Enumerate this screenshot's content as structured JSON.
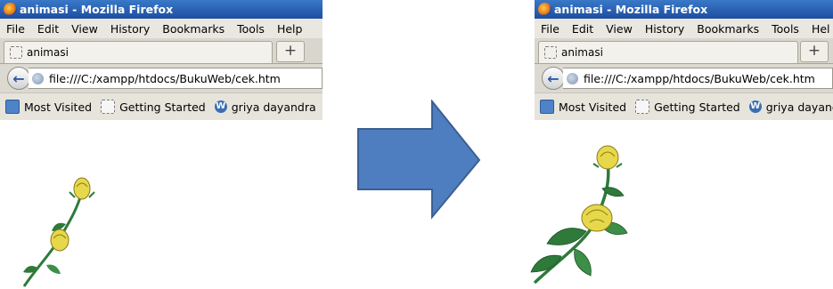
{
  "left_window": {
    "title": "animasi - Mozilla Firefox",
    "menu": [
      "File",
      "Edit",
      "View",
      "History",
      "Bookmarks",
      "Tools",
      "Help"
    ],
    "tab_label": "animasi",
    "new_tab_label": "+",
    "url": "file:///C:/xampp/htdocs/BukuWeb/cek.htm",
    "bookmarks": [
      "Most Visited",
      "Getting Started",
      "griya dayandra"
    ]
  },
  "right_window": {
    "title": "animasi - Mozilla Firefox",
    "menu": [
      "File",
      "Edit",
      "View",
      "History",
      "Bookmarks",
      "Tools",
      "Hel"
    ],
    "tab_label": "animasi",
    "new_tab_label": "+",
    "url": "file:///C:/xampp/htdocs/BukuWeb/cek.htm",
    "bookmarks": [
      "Most Visited",
      "Getting Started",
      "griya dayandr"
    ]
  },
  "icons": {
    "browser": "firefox-icon",
    "back": "back-arrow-icon",
    "site": "globe-icon",
    "arrow": "right-arrow-icon",
    "flower": "yellow-rose-icon"
  },
  "colors": {
    "titlebar": "#2a62b8",
    "arrow_fill": "#4f7ec0",
    "arrow_stroke": "#3a5f93",
    "rose": "#e6d84a",
    "leaf": "#2f7a3a"
  }
}
